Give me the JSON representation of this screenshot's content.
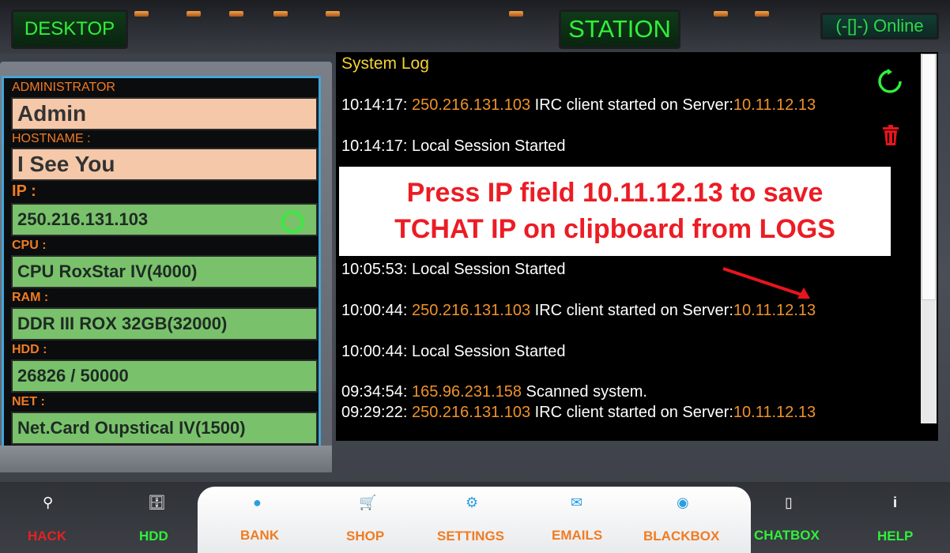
{
  "topbar": {
    "desktop_label": "DESKTOP",
    "station_label": "STATION",
    "online_label": "(-[]-) Online"
  },
  "profile": {
    "admin_label": "ADMINISTRATOR",
    "admin_value": "Admin",
    "hostname_label": "HOSTNAME :",
    "hostname_value": "I See You",
    "ip_label": "IP :",
    "ip_value": "250.216.131.103",
    "cpu_label": "CPU :",
    "cpu_value": "CPU RoxStar IV(4000)",
    "ram_label": "RAM :",
    "ram_value": "DDR III ROX 32GB(32000)",
    "hdd_label": "HDD :",
    "hdd_value": "26826 / 50000",
    "net_label": "NET :",
    "net_value": "Net.Card Oupstical IV(1500)"
  },
  "log": {
    "title": "System Log",
    "lines": [
      {
        "time": "10:14:17: ",
        "ip": "250.216.131.103",
        "text": " IRC client started on Server:",
        "server": "10.11.12.13"
      },
      {
        "time": "10:14:17: ",
        "ip": "",
        "text": "Local Session Started",
        "server": ""
      },
      {
        "time": "10:05:53: ",
        "ip": "",
        "text": "Local Session Started",
        "server": ""
      },
      {
        "time": "10:00:44: ",
        "ip": "250.216.131.103",
        "text": " IRC client started on Server:",
        "server": "10.11.12.13"
      },
      {
        "time": "10:00:44: ",
        "ip": "",
        "text": "Local Session Started",
        "server": ""
      },
      {
        "time": "09:34:54: ",
        "ip": "165.96.231.158",
        "text": " Scanned system.",
        "server": ""
      },
      {
        "time": "09:29:22: ",
        "ip": "250.216.131.103",
        "text": " IRC client started on Server:",
        "server": "10.11.12.13"
      }
    ],
    "banner_line1": "Press IP field 10.11.12.13 to save",
    "banner_line2": "TCHAT IP on clipboard from LOGS"
  },
  "nav": {
    "hack": "HACK",
    "hdd": "HDD",
    "bank": "BANK",
    "shop": "SHOP",
    "settings": "SETTINGS",
    "emails": "EMAILS",
    "blackbox": "BLACKBOX",
    "chatbox": "CHATBOX",
    "help": "HELP"
  },
  "colors": {
    "accent_green": "#2ff03a",
    "accent_orange": "#f07c22",
    "alert_red": "#e52222",
    "panel_border_blue": "#43a5d8"
  }
}
